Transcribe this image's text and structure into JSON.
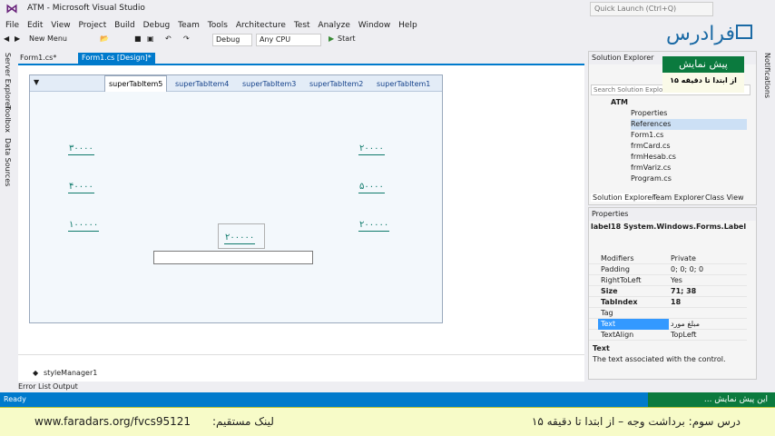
{
  "window": {
    "title": "ATM - Microsoft Visual Studio",
    "quick_launch_placeholder": "Quick Launch (Ctrl+Q)"
  },
  "brand": {
    "logo_text": "فرادرس"
  },
  "menu": [
    "File",
    "Edit",
    "View",
    "Project",
    "Build",
    "Debug",
    "Team",
    "Tools",
    "Architecture",
    "Test",
    "Analyze",
    "Window",
    "Help"
  ],
  "toolbar": {
    "new_menu_label": "New Menu",
    "config_value": "Debug",
    "platform_value": "Any CPU",
    "start_label": "Start"
  },
  "left_strip": [
    "Server Explorer",
    "Toolbox",
    "Data Sources"
  ],
  "doc_tabs": [
    {
      "label": "Form1.cs*"
    },
    {
      "label": "Form1.cs [Design]*"
    }
  ],
  "form": {
    "super_tabs": [
      "superTabItem5",
      "superTabItem4",
      "superTabItem3",
      "superTabItem2",
      "superTabItem1"
    ],
    "amount_labels": {
      "left1": "۳۰۰۰۰",
      "left2": "۴۰۰۰۰",
      "left3": "۱۰۰۰۰۰",
      "right1": "۲۰۰۰۰",
      "right2": "۵۰۰۰۰",
      "right3": "۲۰۰۰۰۰",
      "center": "۲۰۰۰۰۰"
    }
  },
  "tray": {
    "component": "styleManager1"
  },
  "bottom_tabs": [
    "Error List",
    "Output"
  ],
  "solution_explorer": {
    "title": "Solution Explorer",
    "search_placeholder": "Search Solution Explorer",
    "items": [
      "ATM",
      "Properties",
      "References",
      "Form1.cs",
      "frmCard.cs",
      "frmHesab.cs",
      "frmVariz.cs",
      "Program.cs"
    ],
    "tabs": [
      "Solution Explorer",
      "Team Explorer",
      "Class View"
    ]
  },
  "properties": {
    "title": "Properties",
    "object": "label18  System.Windows.Forms.Label",
    "rows": [
      {
        "name": "Modifiers",
        "value": "Private"
      },
      {
        "name": "Padding",
        "value": "0; 0; 0; 0"
      },
      {
        "name": "RightToLeft",
        "value": "Yes"
      },
      {
        "name": "Size",
        "value": "71; 38"
      },
      {
        "name": "TabIndex",
        "value": "18"
      },
      {
        "name": "Tag",
        "value": ""
      },
      {
        "name": "Text",
        "value": "مبلغ مورد"
      },
      {
        "name": "TextAlign",
        "value": "TopLeft"
      }
    ],
    "desc_title": "Text",
    "desc_text": "The text associated with the control."
  },
  "right_strip": [
    "Notifications"
  ],
  "preview_badge": {
    "title": "پیش نمایش",
    "subtitle": "از ابتدا تا دقیقه ۱۵"
  },
  "status": {
    "text": "Ready",
    "preview_text": "این پیش نمایش ..."
  },
  "banner": {
    "link": "www.faradars.org/fvcs95121",
    "link_label": "لینک مستقیم:",
    "lesson": "درس سوم: برداشت وجه – از ابتدا تا دقیقه ۱۵"
  }
}
